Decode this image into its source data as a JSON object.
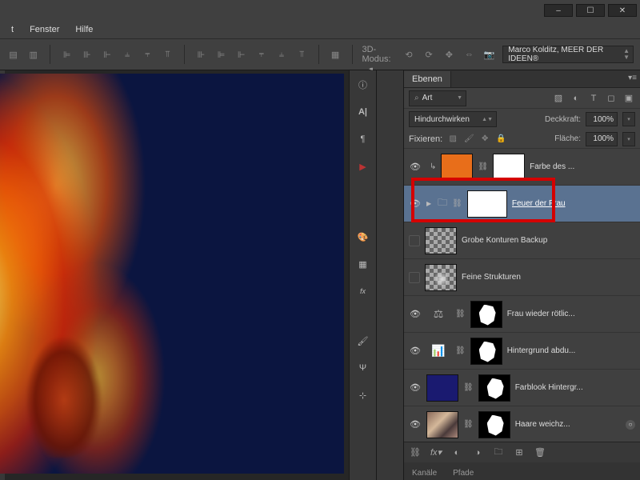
{
  "menubar": {
    "items": [
      "t",
      "Fenster",
      "Hilfe"
    ]
  },
  "window_controls": {
    "minimize": "–",
    "maximize": "☐",
    "close": "✕"
  },
  "optbar": {
    "mode_label": "3D-Modus:",
    "profile": "Marco Kolditz, MEER DER IDEEN®"
  },
  "panels": {
    "layers_tab": "Ebenen",
    "channels_tab": "Kanäle",
    "paths_tab": "Pfade"
  },
  "layers_panel": {
    "filter_label": "Art",
    "blend_mode": "Hindurchwirken",
    "opacity_label": "Deckkraft:",
    "opacity_value": "100%",
    "lock_label": "Fixieren:",
    "fill_label": "Fläche:",
    "fill_value": "100%",
    "layers": [
      {
        "name": "Farbe des ...",
        "visible": true,
        "type": "clip-fill",
        "color": "orange"
      },
      {
        "name": "Feuer der Frau",
        "visible": true,
        "type": "group",
        "selected": true
      },
      {
        "name": "Grobe Konturen Backup",
        "visible": false,
        "type": "raster-checker"
      },
      {
        "name": "Feine Strukturen",
        "visible": false,
        "type": "raster-smoke"
      },
      {
        "name": "Frau wieder rötlic...",
        "visible": true,
        "type": "adj-balance"
      },
      {
        "name": "Hintergrund abdu...",
        "visible": true,
        "type": "adj-levels"
      },
      {
        "name": "Farblook Hintergr...",
        "visible": true,
        "type": "fill-navy"
      },
      {
        "name": "Haare weichz...",
        "visible": true,
        "type": "photo",
        "fx": true
      }
    ]
  }
}
